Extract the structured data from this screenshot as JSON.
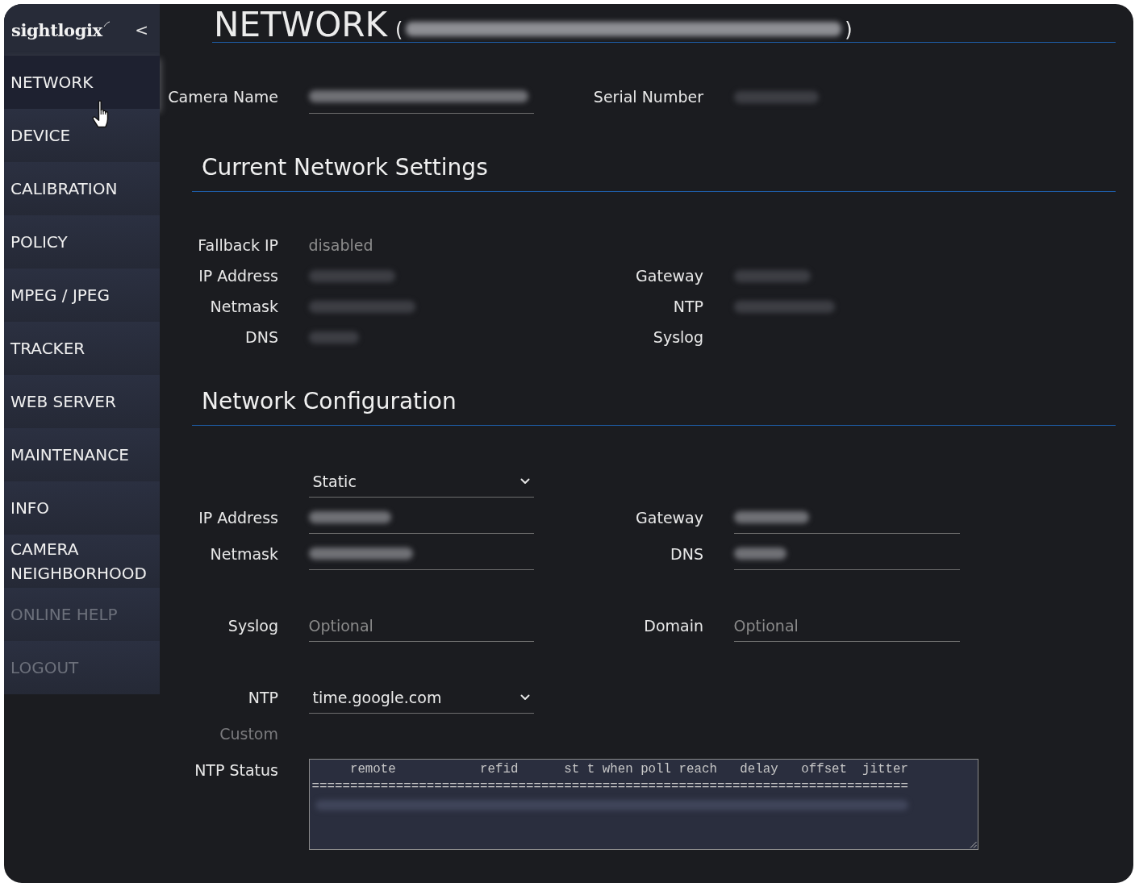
{
  "sidebar": {
    "logo": "sightlogix",
    "collapse": "<",
    "items": [
      {
        "label": "NETWORK",
        "selected": true,
        "disabled": false
      },
      {
        "label": "DEVICE",
        "selected": false,
        "disabled": false
      },
      {
        "label": "CALIBRATION",
        "selected": false,
        "disabled": false
      },
      {
        "label": "POLICY",
        "selected": false,
        "disabled": false
      },
      {
        "label": "MPEG / JPEG",
        "selected": false,
        "disabled": false
      },
      {
        "label": "TRACKER",
        "selected": false,
        "disabled": false
      },
      {
        "label": "WEB SERVER",
        "selected": false,
        "disabled": false
      },
      {
        "label": "MAINTENANCE",
        "selected": false,
        "disabled": false
      },
      {
        "label": "INFO",
        "selected": false,
        "disabled": false
      },
      {
        "label": "CAMERA NEIGHBORHOOD",
        "selected": false,
        "disabled": false
      },
      {
        "label": "ONLINE HELP",
        "selected": false,
        "disabled": true
      },
      {
        "label": "LOGOUT",
        "selected": false,
        "disabled": true
      }
    ]
  },
  "header": {
    "title": "NETWORK",
    "open": "(",
    "close": ")",
    "redacted": true
  },
  "identity": [
    {
      "label": "Camera Name",
      "kind": "input",
      "redacted": true
    },
    {
      "label": "Serial Number",
      "kind": "text",
      "redacted": true
    }
  ],
  "current_settings": {
    "heading": "Current Network Settings",
    "rows": [
      {
        "left": {
          "label": "Fallback IP",
          "value": "disabled",
          "redacted": false
        }
      },
      {
        "left": {
          "label": "IP Address",
          "redacted": true
        },
        "right": {
          "label": "Gateway",
          "redacted": true
        }
      },
      {
        "left": {
          "label": "Netmask",
          "redacted": true
        },
        "right": {
          "label": "NTP",
          "redacted": true
        }
      },
      {
        "left": {
          "label": "DNS",
          "redacted": true
        },
        "right": {
          "label": "Syslog"
        }
      }
    ]
  },
  "network_configuration": {
    "heading": "Network Configuration",
    "groups": [
      {
        "rows": [
          {
            "left": {
              "kind": "select",
              "value": "Static"
            }
          },
          {
            "left": {
              "label": "IP Address",
              "kind": "input",
              "redacted": true
            },
            "right": {
              "label": "Gateway",
              "kind": "input",
              "redacted": true
            }
          },
          {
            "left": {
              "label": "Netmask",
              "kind": "input",
              "redacted": true
            },
            "right": {
              "label": "DNS",
              "kind": "input",
              "redacted": true
            }
          }
        ]
      },
      {
        "rows": [
          {
            "left": {
              "label": "Syslog",
              "kind": "input",
              "placeholder": "Optional",
              "redacted": false
            },
            "right": {
              "label": "Domain",
              "kind": "input",
              "placeholder": "Optional",
              "redacted": false
            }
          }
        ]
      },
      {
        "rows": [
          {
            "left": {
              "label": "NTP",
              "kind": "select",
              "value": "time.google.com"
            }
          },
          {
            "left": {
              "label": "Custom",
              "kind": "label",
              "disabled": true
            }
          },
          {
            "left": {
              "label": "NTP Status",
              "kind": "textarea",
              "lines": [
                "     remote           refid      st t when poll reach   delay   offset  jitter",
                "=============================================================================="
              ],
              "redacted": true
            }
          }
        ]
      }
    ]
  }
}
